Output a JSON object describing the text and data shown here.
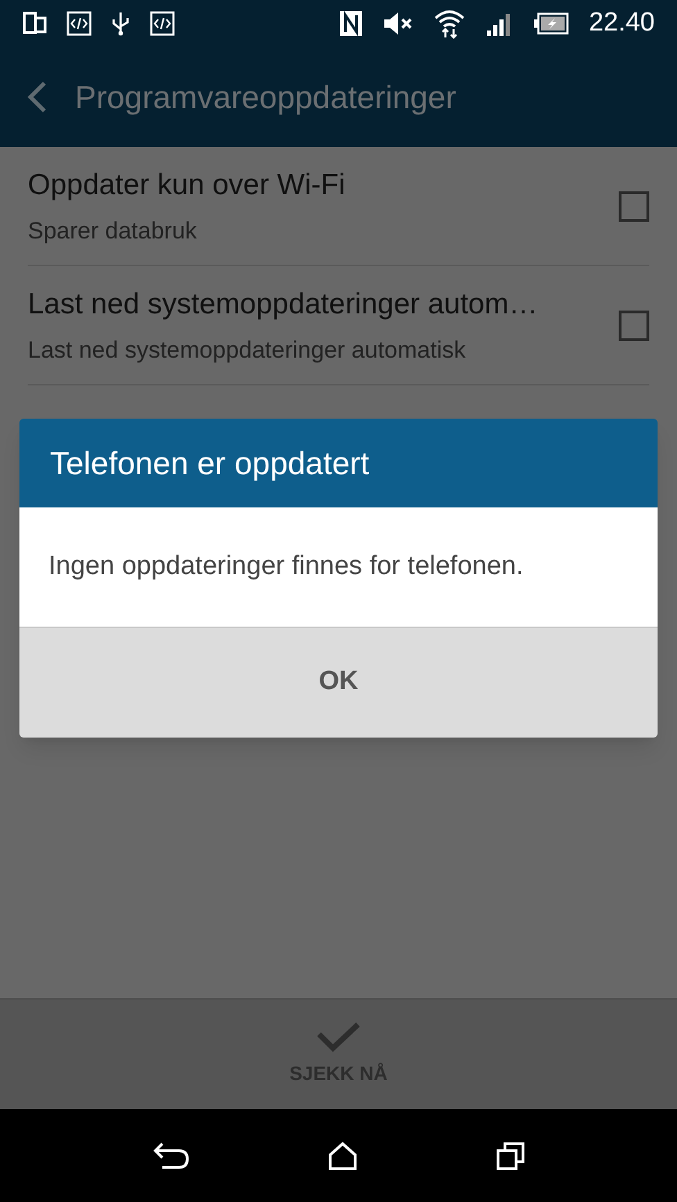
{
  "status_bar": {
    "time": "22.40"
  },
  "app_bar": {
    "title": "Programvareoppdateringer"
  },
  "settings": [
    {
      "title": "Oppdater kun over Wi-Fi",
      "subtitle": "Sparer databruk",
      "checked": false
    },
    {
      "title": "Last ned systemoppdateringer autom…",
      "subtitle": "Last ned systemoppdateringer automatisk",
      "checked": false
    }
  ],
  "dialog": {
    "title": "Telefonen er oppdatert",
    "message": "Ingen oppdateringer finnes for telefonen.",
    "button": "OK"
  },
  "bottom_action": {
    "label": "SJEKK NÅ"
  }
}
